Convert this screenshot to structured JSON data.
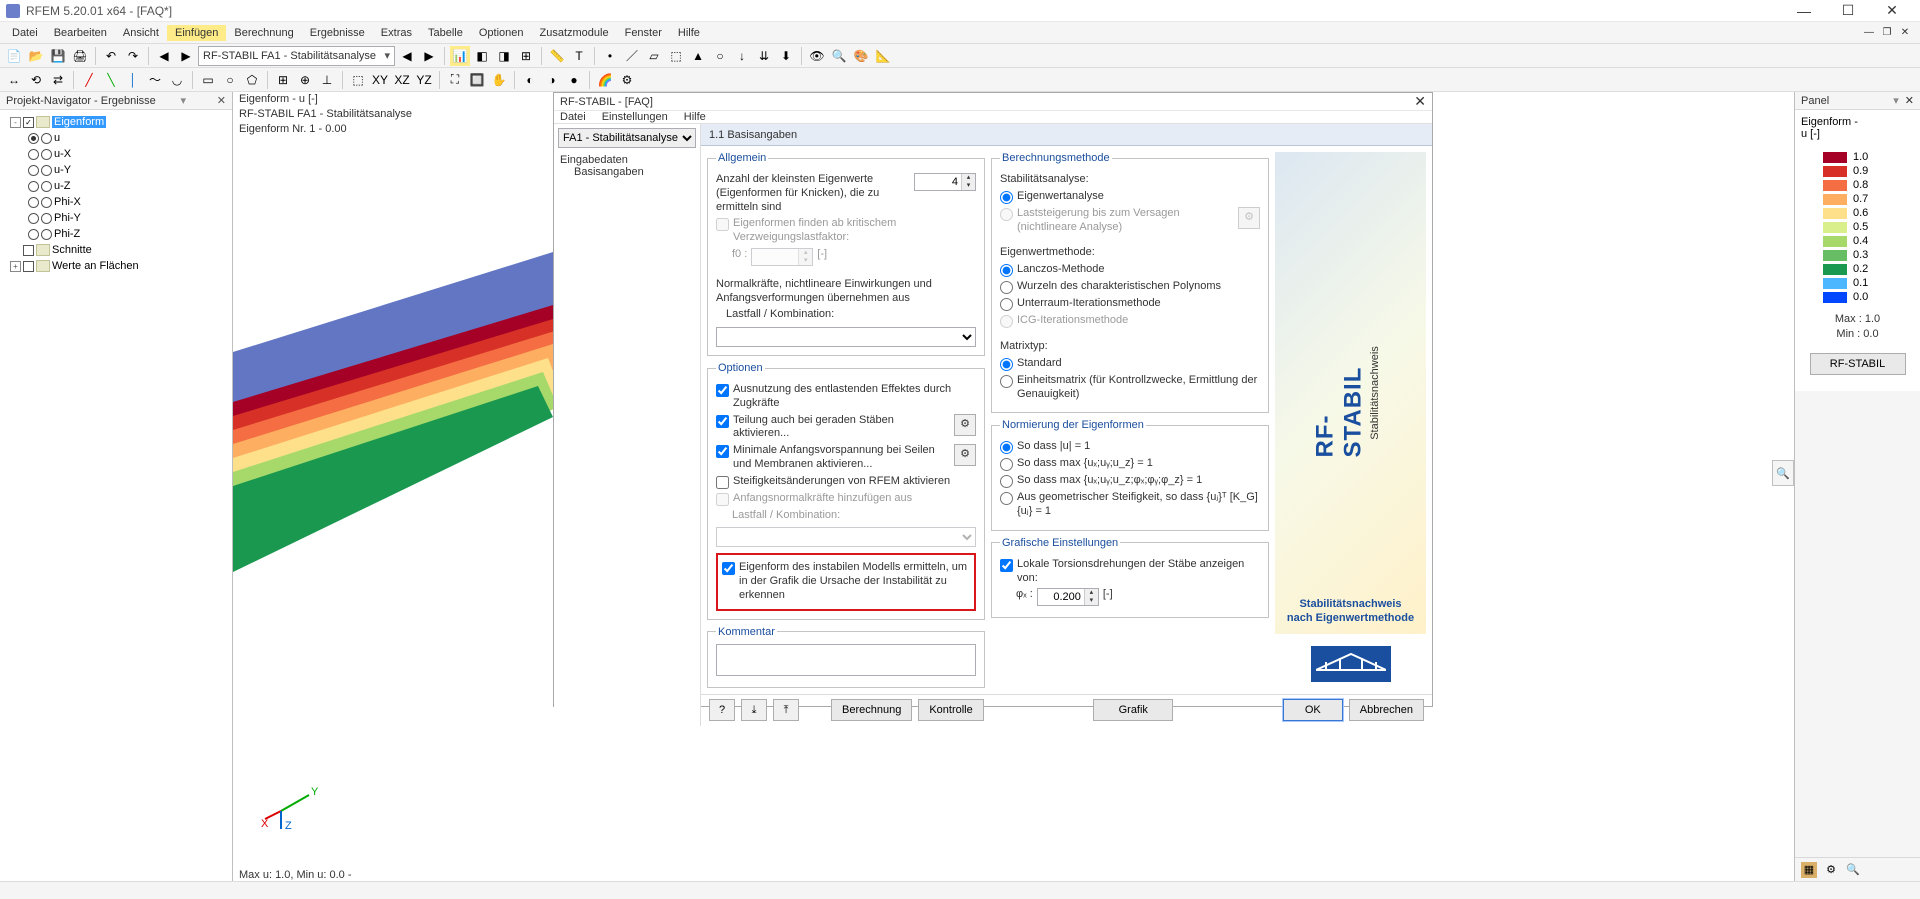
{
  "window": {
    "title": "RFEM 5.20.01 x64 - [FAQ*]"
  },
  "menus": [
    "Datei",
    "Bearbeiten",
    "Ansicht",
    "Einfügen",
    "Berechnung",
    "Ergebnisse",
    "Extras",
    "Tabelle",
    "Optionen",
    "Zusatzmodule",
    "Fenster",
    "Hilfe"
  ],
  "activeMenu": 3,
  "toolbarCombo": "RF-STABIL FA1 - Stabilitätsanalyse",
  "navigator": {
    "title": "Projekt-Navigator - Ergebnisse",
    "rows": [
      {
        "indent": 0,
        "exp": "-",
        "chk": true,
        "icon": true,
        "label": "Eigenform",
        "selected": true
      },
      {
        "indent": 1,
        "radio": true,
        "radioSel": true,
        "label": "u"
      },
      {
        "indent": 1,
        "radio": true,
        "label": "u-X"
      },
      {
        "indent": 1,
        "radio": true,
        "label": "u-Y"
      },
      {
        "indent": 1,
        "radio": true,
        "label": "u-Z"
      },
      {
        "indent": 1,
        "radio": true,
        "label": "Phi-X"
      },
      {
        "indent": 1,
        "radio": true,
        "label": "Phi-Y"
      },
      {
        "indent": 1,
        "radio": true,
        "label": "Phi-Z"
      },
      {
        "indent": 0,
        "chk": false,
        "icon": true,
        "label": "Schnitte"
      },
      {
        "indent": 0,
        "exp": "+",
        "chk": false,
        "icon": true,
        "label": "Werte an Flächen"
      }
    ]
  },
  "viewport": {
    "line1": "Eigenform - u [-]",
    "line2": "RF-STABIL FA1 - Stabilitätsanalyse",
    "line3": "Eigenform Nr. 1  -  0.00",
    "footer": "Max u: 1.0, Min u: 0.0 -"
  },
  "panel": {
    "title": "Panel",
    "sub1": "Eigenform -",
    "sub2": "u [-]",
    "legend": [
      {
        "color": "#a50026",
        "val": "1.0"
      },
      {
        "color": "#d73027",
        "val": "0.9"
      },
      {
        "color": "#f46d43",
        "val": "0.8"
      },
      {
        "color": "#fdae61",
        "val": "0.7"
      },
      {
        "color": "#fee08b",
        "val": "0.6"
      },
      {
        "color": "#d9ef8b",
        "val": "0.5"
      },
      {
        "color": "#a6d96a",
        "val": "0.4"
      },
      {
        "color": "#66bd63",
        "val": "0.3"
      },
      {
        "color": "#1a9850",
        "val": "0.2"
      },
      {
        "color": "#4cb6ff",
        "val": "0.1"
      },
      {
        "color": "#0047ff",
        "val": "0.0"
      }
    ],
    "max": "Max  :  1.0",
    "min": "Min   :  0.0",
    "button": "RF-STABIL"
  },
  "dialog": {
    "title": "RF-STABIL - [FAQ]",
    "menus": [
      "Datei",
      "Einstellungen",
      "Hilfe"
    ],
    "caseSelect": "FA1 - Stabilitätsanalyse",
    "navRoot": "Eingabedaten",
    "navChild": "Basisangaben",
    "section": "1.1 Basisangaben",
    "groups": {
      "allgemein": {
        "title": "Allgemein",
        "eigenwerteLabel": "Anzahl der kleinsten Eigenwerte (Eigenformen für Knicken), die zu ermitteln sind",
        "eigenwerteVal": "4",
        "eigenformenVZF": "Eigenformen finden ab kritischem Verzweigungslastfaktor:",
        "foLabel": "f0 :",
        "foUnit": "[-]",
        "normalLabel": "Normalkräfte, nichtlineare Einwirkungen und Anfangsverformungen übernehmen aus",
        "lfLabel": "Lastfall / Kombination:"
      },
      "optionen": {
        "title": "Optionen",
        "opt1": "Ausnutzung des entlastenden Effektes durch Zugkräfte",
        "opt2": "Teilung auch bei geraden Stäben aktivieren...",
        "opt3": "Minimale Anfangsvorspannung bei Seilen und Membranen aktivieren...",
        "opt4": "Steifigkeitsänderungen von RFEM aktivieren",
        "opt5": "Anfangsnormalkräfte hinzufügen aus",
        "opt5Lf": "Lastfall / Kombination:",
        "opt6": "Eigenform des instabilen Modells ermitteln, um in der Grafik die Ursache der Instabilität zu erkennen"
      },
      "berech": {
        "title": "Berechnungsmethode",
        "stabLabel": "Stabilitätsanalyse:",
        "r1": "Eigenwertanalyse",
        "r2": "Laststeigerung bis zum Versagen (nichtlineare Analyse)",
        "eigenmLabel": "Eigenwertmethode:",
        "m1": "Lanczos-Methode",
        "m2": "Wurzeln des charakteristischen Polynoms",
        "m3": "Unterraum-Iterationsmethode",
        "m4": "ICG-Iterationsmethode",
        "matrixLabel": "Matrixtyp:",
        "mt1": "Standard",
        "mt2": "Einheitsmatrix (für Kontrollzwecke, Ermittlung der Genauigkeit)"
      },
      "norm": {
        "title": "Normierung der Eigenformen",
        "n1": "So dass |u| = 1",
        "n2": "So dass max {uₓ;uᵧ;u_z} = 1",
        "n3": "So dass max {uₓ;uᵧ;u_z;φₓ;φᵧ;φ_z} = 1",
        "n4": "Aus geometrischer Steifigkeit, so dass {uⱼ}ᵀ [K_G] {uⱼ} = 1"
      },
      "graf": {
        "title": "Grafische Einstellungen",
        "g1": "Lokale Torsionsdrehungen der Stäbe anzeigen von:",
        "phiLabel": "φₓ :",
        "phiVal": "0.200",
        "phiUnit": "[-]"
      },
      "kommentar": {
        "title": "Kommentar"
      }
    },
    "logo": {
      "text": "RF-STABIL",
      "sub": "Stabilitätsnachweis",
      "caption1": "Stabilitätsnachweis",
      "caption2": "nach Eigenwertmethode"
    },
    "footer": {
      "berechnung": "Berechnung",
      "kontrolle": "Kontrolle",
      "grafik": "Grafik",
      "ok": "OK",
      "abbrechen": "Abbrechen"
    }
  }
}
